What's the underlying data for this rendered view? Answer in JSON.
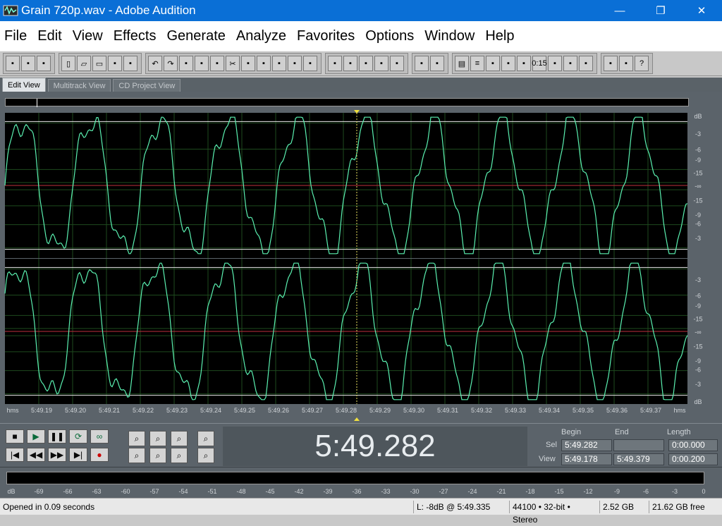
{
  "window": {
    "title": "Grain 720p.wav - Adobe Audition",
    "minimize_glyph": "—",
    "maximize_glyph": "❐",
    "close_glyph": "✕"
  },
  "menu": [
    "File",
    "Edit",
    "View",
    "Effects",
    "Generate",
    "Analyze",
    "Favorites",
    "Options",
    "Window",
    "Help"
  ],
  "toolbar_groups": [
    [
      "waveform-view-icon",
      "multitrack-icon",
      "cd-icon"
    ],
    [
      "new-file-icon",
      "open-file-icon",
      "save-icon",
      "save-all-icon",
      "save-selection-icon"
    ],
    [
      "undo-icon",
      "redo-icon",
      "repeat-icon",
      "copy-icon",
      "copy-new-icon",
      "cut-icon",
      "paste-icon",
      "paste-new-icon",
      "mix-paste-icon",
      "crop-icon",
      "insert-icon"
    ],
    [
      "waveform-icon",
      "spectral-icon",
      "pitch-icon",
      "pan-icon",
      "phase-icon"
    ],
    [
      "time-select-icon",
      "marquee-icon"
    ],
    [
      "settings-icon",
      "list-icon",
      "cue-icon",
      "play-list-icon",
      "zoom-panel-icon",
      "time-icon",
      "fx-icon",
      "level-icon",
      "meter-icon"
    ],
    [
      "tools-icon",
      "info-icon",
      "help-icon"
    ]
  ],
  "tabs": [
    {
      "label": "Edit View",
      "active": true
    },
    {
      "label": "Multitrack View",
      "active": false
    },
    {
      "label": "CD Project View",
      "active": false
    }
  ],
  "waveform": {
    "db_scale": [
      "dB",
      "-3",
      "-6",
      "-9",
      "-15",
      "-∞",
      "-15",
      "-9",
      "-6",
      "-3"
    ],
    "db_scale_bottom": [
      "-3",
      "-6",
      "-9",
      "-15",
      "-∞",
      "-15",
      "-9",
      "-6",
      "-3",
      "dB"
    ],
    "time_ticks": [
      "hms",
      "5:49.19",
      "5:49.20",
      "5:49.21",
      "5:49.22",
      "5:49.23",
      "5:49.24",
      "5:49.25",
      "5:49.26",
      "5:49.27",
      "5:49.28",
      "5:49.29",
      "5:49.30",
      "5:49.31",
      "5:49.32",
      "5:49.33",
      "5:49.34",
      "5:49.35",
      "5:49.36",
      "5:49.37",
      "hms"
    ],
    "wave_color": "#5af0b0",
    "center_line_color": "#c0303c",
    "background_color": "#000000"
  },
  "transport": {
    "buttons": [
      "stop-icon",
      "play-icon",
      "pause-icon",
      "play-to-end-icon",
      "loop-icon",
      "go-to-start-icon",
      "rewind-icon",
      "fast-forward-icon",
      "go-to-end-icon",
      "record-icon"
    ]
  },
  "zoom": {
    "buttons": [
      "zoom-in-horizontal-icon",
      "zoom-out-horizontal-icon",
      "zoom-full-icon",
      "zoom-in-vertical-icon",
      "zoom-left-icon",
      "zoom-right-icon",
      "zoom-selection-icon",
      "zoom-out-vertical-icon"
    ]
  },
  "time_display": "5:49.282",
  "sel_view": {
    "col_begin": "Begin",
    "col_end": "End",
    "col_length": "Length",
    "sel_label": "Sel",
    "view_label": "View",
    "sel_begin": "5:49.282",
    "sel_end": "",
    "sel_length": "0:00.000",
    "view_begin": "5:49.178",
    "view_end": "5:49.379",
    "view_length": "0:00.200"
  },
  "meter": {
    "scale": [
      "dB",
      "-69",
      "-66",
      "-63",
      "-60",
      "-57",
      "-54",
      "-51",
      "-48",
      "-45",
      "-42",
      "-39",
      "-36",
      "-33",
      "-30",
      "-27",
      "-24",
      "-21",
      "-18",
      "-15",
      "-12",
      "-9",
      "-6",
      "-3",
      "0"
    ]
  },
  "status": {
    "message": "Opened in 0.09 seconds",
    "level": "L: -8dB @  5:49.335",
    "format": "44100 • 32-bit • Stereo",
    "file_size": "2.52 GB",
    "free_space": "21.62 GB free"
  }
}
